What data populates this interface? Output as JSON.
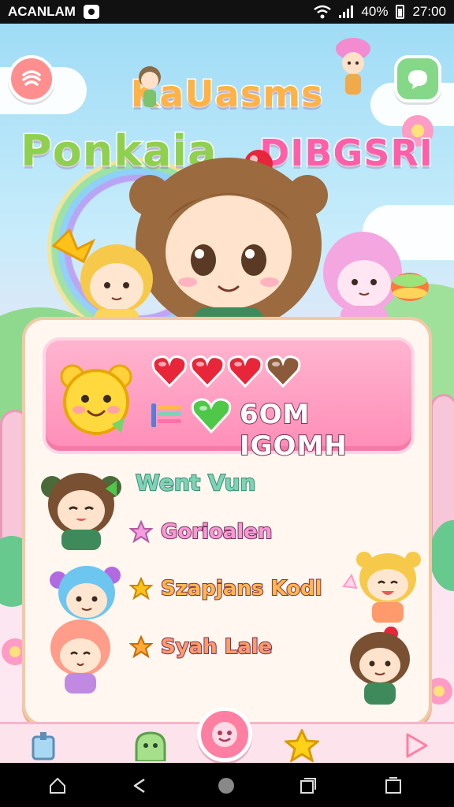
{
  "status_bar": {
    "carrier": "ACANLAM",
    "battery": "40%",
    "time": "27:00"
  },
  "title": {
    "line1": "KaUasms",
    "line2_left": "Ponkaia",
    "line2_right": "DIBGSRI"
  },
  "player": {
    "hearts_full": 3,
    "hearts_total": 4,
    "score_text": "6OM IGOMH"
  },
  "friends": {
    "heading": "Went Vun",
    "items": [
      {
        "label": "Gorioalen"
      },
      {
        "label": "Szapjans Kodl"
      },
      {
        "label": "Syah Lale"
      }
    ]
  },
  "colors": {
    "accent_pink": "#ff8db7",
    "heart_red": "#e8263a",
    "heading_green": "#7ed3b6",
    "nav_center": "#ff7fa2"
  },
  "icons": [
    "menu-icon",
    "chat-icon",
    "heart-icon",
    "star-icon",
    "home-icon",
    "ghost-icon",
    "face-icon",
    "play-icon"
  ]
}
